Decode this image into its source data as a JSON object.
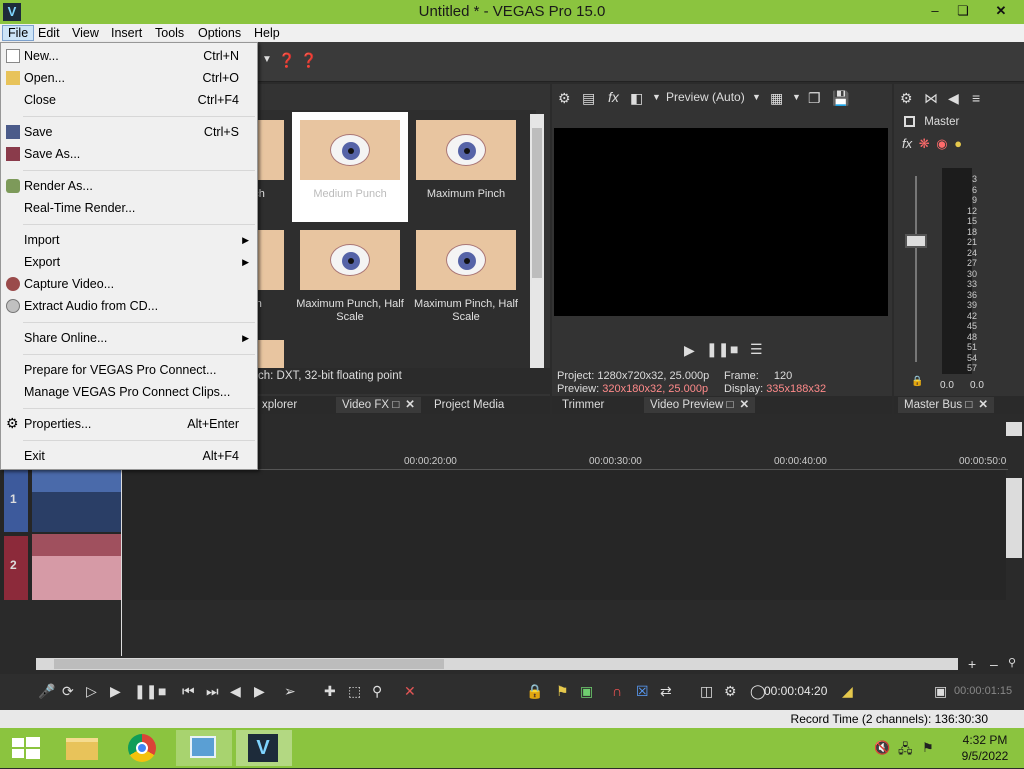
{
  "window": {
    "title": "Untitled * - VEGAS Pro 15.0",
    "app_icon_letter": "V"
  },
  "menu": [
    "File",
    "Edit",
    "View",
    "Insert",
    "Tools",
    "Options",
    "Help"
  ],
  "file_menu": {
    "new": {
      "label": "New...",
      "shortcut": "Ctrl+N"
    },
    "open": {
      "label": "Open...",
      "shortcut": "Ctrl+O"
    },
    "close": {
      "label": "Close",
      "shortcut": "Ctrl+F4"
    },
    "save": {
      "label": "Save",
      "shortcut": "Ctrl+S"
    },
    "save_as": {
      "label": "Save As..."
    },
    "render_as": {
      "label": "Render As..."
    },
    "realtime_render": {
      "label": "Real-Time Render..."
    },
    "import": {
      "label": "Import"
    },
    "export": {
      "label": "Export"
    },
    "capture_video": {
      "label": "Capture Video..."
    },
    "extract_audio": {
      "label": "Extract Audio from CD..."
    },
    "share_online": {
      "label": "Share Online..."
    },
    "prepare_connect": {
      "label": "Prepare for VEGAS Pro Connect..."
    },
    "manage_connect": {
      "label": "Manage VEGAS Pro Connect Clips..."
    },
    "properties": {
      "label": "Properties...",
      "shortcut": "Alt+Enter"
    },
    "exit": {
      "label": "Exit",
      "shortcut": "Alt+F4"
    }
  },
  "fx_presets": {
    "items": [
      "nch",
      "Medium Punch",
      "Maximum Pinch",
      "ch",
      "Maximum Punch, Half Scale",
      "Maximum Pinch, Half Scale"
    ],
    "info": "ch: DXT, 32-bit floating point"
  },
  "left_tabs": {
    "explorer": "xplorer",
    "video_fx": "Video FX",
    "project_media": "Project Media"
  },
  "preview": {
    "mode": "Preview (Auto)",
    "project_label": "Project:",
    "project_value": "1280x720x32, 25.000p",
    "preview_label": "Preview:",
    "preview_value": "320x180x32, 25.000p",
    "frame_label": "Frame:",
    "frame_value": "120",
    "display_label": "Display:",
    "display_value": "335x188x32",
    "tab_trimmer": "Trimmer",
    "tab_video_preview": "Video Preview"
  },
  "master": {
    "label": "Master",
    "tab": "Master Bus",
    "scale": [
      "3",
      "6",
      "9",
      "12",
      "15",
      "18",
      "21",
      "24",
      "27",
      "30",
      "33",
      "36",
      "39",
      "42",
      "45",
      "48",
      "51",
      "54",
      "57"
    ],
    "left_value": "0.0",
    "right_value": "0.0"
  },
  "timeline": {
    "ticks": [
      "00:00:20:00",
      "00:00:30:00",
      "00:00:40:00",
      "00:00:50:0"
    ],
    "track1": "1",
    "track2": "2",
    "cursor_time": "00:00:04:20",
    "length_time": "00:00:01:15"
  },
  "status": {
    "record_time": "Record Time (2 channels): 136:30:30"
  },
  "taskbar": {
    "time": "4:32 PM",
    "date": "9/5/2022"
  },
  "colors": {
    "title_green": "#8bc43f",
    "menu_bg": "#f0f0f0",
    "panel_dark": "#333333",
    "preview_pink": "#ff8a8a"
  }
}
